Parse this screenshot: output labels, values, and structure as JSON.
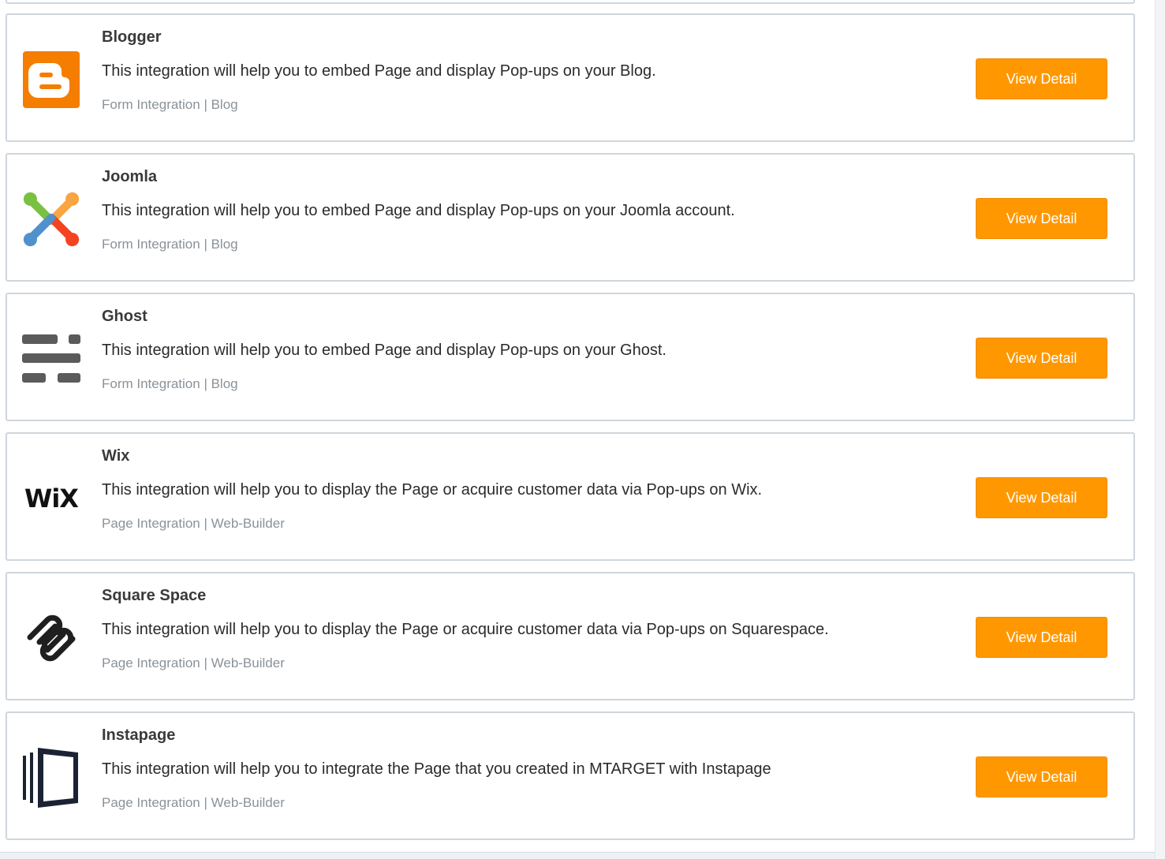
{
  "integrations": [
    {
      "name": "Blogger",
      "description": "This integration will help you to embed Page and display Pop-ups on your Blog.",
      "tags": "Form Integration | Blog",
      "button_label": "View Detail",
      "icon": "blogger-icon"
    },
    {
      "name": "Joomla",
      "description": "This integration will help you to embed Page and display Pop-ups on your Joomla account.",
      "tags": "Form Integration | Blog",
      "button_label": "View Detail",
      "icon": "joomla-icon"
    },
    {
      "name": "Ghost",
      "description": "This integration will help you to embed Page and display Pop-ups on your Ghost.",
      "tags": "Form Integration | Blog",
      "button_label": "View Detail",
      "icon": "ghost-icon"
    },
    {
      "name": "Wix",
      "description": "This integration will help you to display the Page or acquire customer data via Pop-ups on Wix.",
      "tags": "Page Integration | Web-Builder",
      "button_label": "View Detail",
      "icon": "wix-icon",
      "logo_text": "WiX"
    },
    {
      "name": "Square Space",
      "description": "This integration will help you to display the Page or acquire customer data via Pop-ups on Squarespace.",
      "tags": "Page Integration | Web-Builder",
      "button_label": "View Detail",
      "icon": "squarespace-icon"
    },
    {
      "name": "Instapage",
      "description": "This integration will help you to integrate the Page that you created in MTARGET with Instapage",
      "tags": "Page Integration | Web-Builder",
      "button_label": "View Detail",
      "icon": "instapage-icon"
    }
  ],
  "colors": {
    "button_bg": "#ff9800",
    "button_text": "#ffffff",
    "card_border": "#cfd6dc",
    "tag_text": "#8a9299",
    "blogger_orange": "#f57d00"
  }
}
